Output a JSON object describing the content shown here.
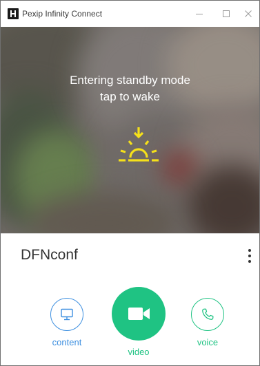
{
  "window": {
    "title": "Pexip Infinity Connect",
    "controls": [
      "minimize-icon",
      "maximize-icon",
      "close-icon"
    ]
  },
  "standby": {
    "line1": "Entering standby mode",
    "line2": "tap to wake",
    "icon": "sunrise-icon",
    "icon_color": "#f5e01a"
  },
  "conference": {
    "name": "DFNconf",
    "menu_icon": "more-vertical-icon"
  },
  "controls": {
    "content": {
      "label": "content",
      "icon": "monitor-icon",
      "color": "#3d8fe0"
    },
    "video": {
      "label": "video",
      "icon": "video-camera-icon",
      "color": "#1fc383"
    },
    "voice": {
      "label": "voice",
      "icon": "phone-icon",
      "color": "#1fc383"
    }
  }
}
